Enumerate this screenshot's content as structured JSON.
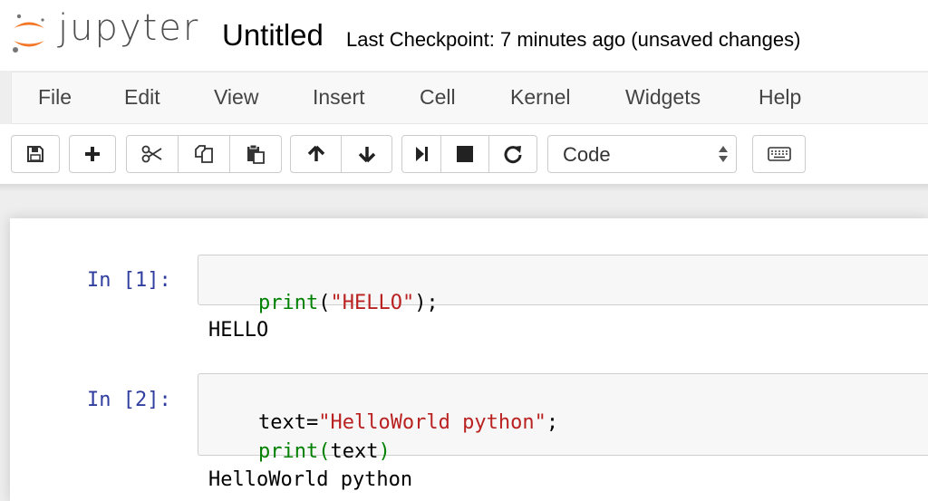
{
  "header": {
    "logo_text": "jupyter",
    "notebook_name": "Untitled",
    "checkpoint": "Last Checkpoint: 7 minutes ago (unsaved changes)"
  },
  "menu": [
    "File",
    "Edit",
    "View",
    "Insert",
    "Cell",
    "Kernel",
    "Widgets",
    "Help"
  ],
  "toolbar": {
    "cell_type": "Code",
    "icons": [
      "save-icon",
      "plus-icon",
      "scissors-icon",
      "copy-icon",
      "paste-icon",
      "arrow-up-icon",
      "arrow-down-icon",
      "run-icon",
      "stop-icon",
      "restart-icon",
      "keyboard-icon"
    ]
  },
  "cells": [
    {
      "prompt": "In [1]:",
      "code": [
        [
          [
            "print",
            "kw"
          ],
          [
            "(",
            "punc"
          ],
          [
            "\"HELLO\"",
            "str"
          ],
          [
            ");",
            "punc"
          ]
        ]
      ],
      "output": "HELLO"
    },
    {
      "prompt": "In [2]:",
      "code": [
        [
          [
            "text=",
            "punc"
          ],
          [
            "\"HelloWorld python\"",
            "str"
          ],
          [
            ";",
            "punc"
          ]
        ],
        [
          [
            "print",
            "kw"
          ],
          [
            "(",
            "kw"
          ],
          [
            "text",
            "punc"
          ],
          [
            ")",
            "kw"
          ]
        ]
      ],
      "output": "HelloWorld python"
    }
  ],
  "colors": {
    "logo_orange": "#f37726",
    "prompt_blue": "#303f9f",
    "keyword_green": "#008000",
    "string_red": "#ba2121"
  }
}
